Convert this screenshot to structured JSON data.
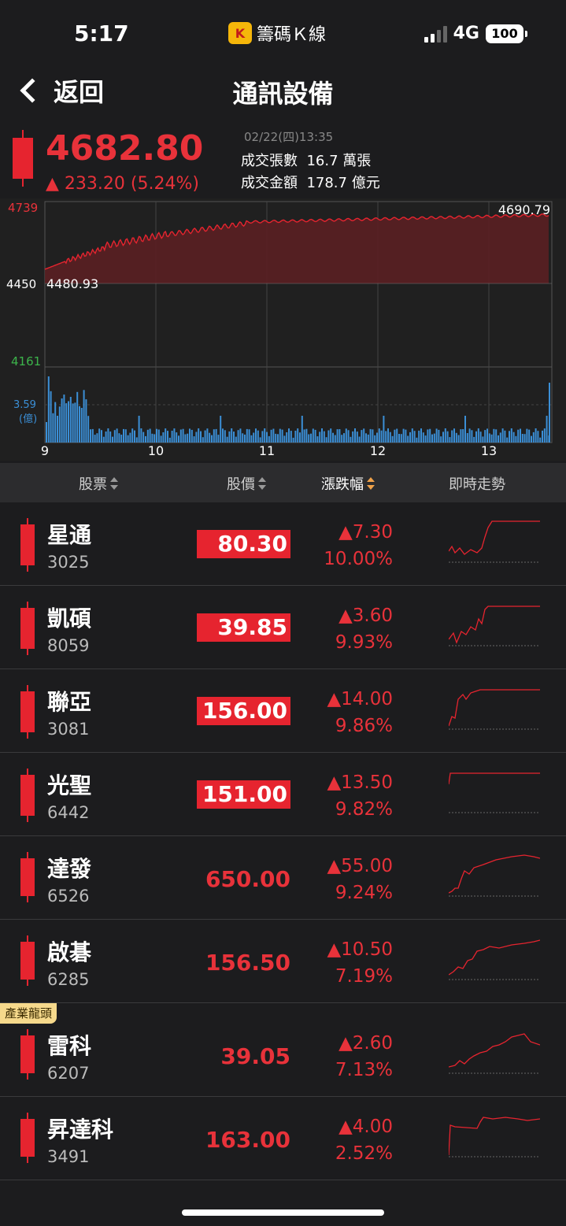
{
  "status_bar": {
    "time": "5:17",
    "app_name": "籌碼Ｋ線",
    "network": "4G",
    "battery": "100"
  },
  "nav": {
    "back_label": "返回",
    "title": "通訊設備"
  },
  "index": {
    "price": "4682.80",
    "change": "▲ 233.20 (5.24%)",
    "date": "02/22(四)13:35",
    "volume_label": "成交張數",
    "volume_value": "16.7 萬張",
    "amount_label": "成交金額",
    "amount_value": "178.7 億元"
  },
  "chart_data": {
    "type": "line",
    "y_high_label": "4739",
    "y_mid_label": "4450",
    "y_low_label": "4161",
    "open_label": "4480.93",
    "last_label": "4690.79",
    "volume_max_label": "3.59",
    "volume_unit_label": "(億)",
    "x_ticks": [
      "9",
      "10",
      "11",
      "12",
      "13"
    ],
    "colors": {
      "up": "#e6242f",
      "low": "#3cb44b",
      "volume": "#3b8fd6"
    }
  },
  "table": {
    "headers": {
      "stock": "股票",
      "price": "股價",
      "change": "漲跌幅",
      "trend": "即時走勢"
    },
    "rows": [
      {
        "name": "星通",
        "code": "3025",
        "price": "80.30",
        "limit_up": true,
        "change": "▲7.30",
        "pct": "10.00%"
      },
      {
        "name": "凱碩",
        "code": "8059",
        "price": "39.85",
        "limit_up": true,
        "change": "▲3.60",
        "pct": "9.93%"
      },
      {
        "name": "聯亞",
        "code": "3081",
        "price": "156.00",
        "limit_up": true,
        "change": "▲14.00",
        "pct": "9.86%"
      },
      {
        "name": "光聖",
        "code": "6442",
        "price": "151.00",
        "limit_up": true,
        "change": "▲13.50",
        "pct": "9.82%"
      },
      {
        "name": "達發",
        "code": "6526",
        "price": "650.00",
        "limit_up": false,
        "change": "▲55.00",
        "pct": "9.24%"
      },
      {
        "name": "啟碁",
        "code": "6285",
        "price": "156.50",
        "limit_up": false,
        "change": "▲10.50",
        "pct": "7.19%"
      },
      {
        "name": "雷科",
        "code": "6207",
        "price": "39.05",
        "limit_up": false,
        "change": "▲2.60",
        "pct": "7.13%",
        "badge": "產業龍頭"
      },
      {
        "name": "昇達科",
        "code": "3491",
        "price": "163.00",
        "limit_up": false,
        "change": "▲4.00",
        "pct": "2.52%"
      }
    ]
  }
}
